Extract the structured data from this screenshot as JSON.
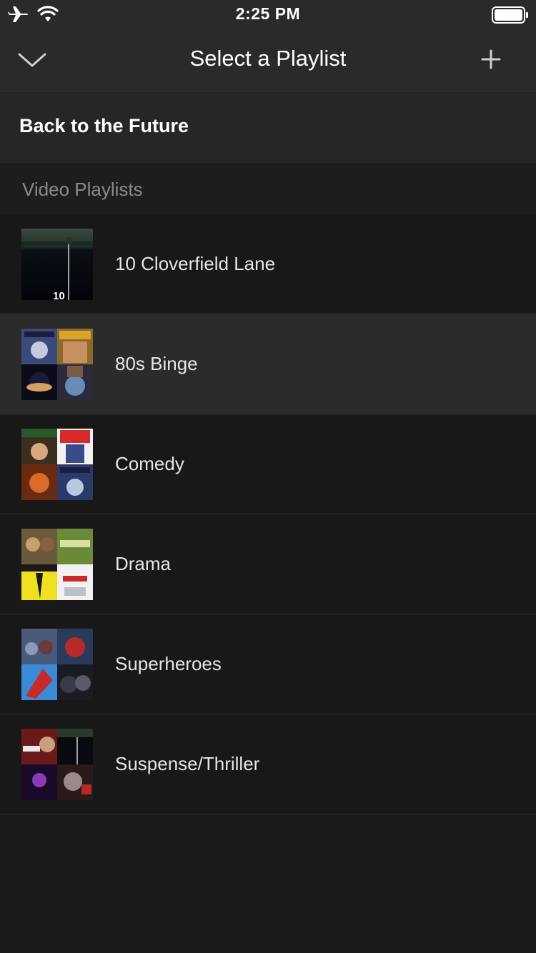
{
  "status_bar": {
    "time": "2:25 PM",
    "icons": [
      "airplane-icon",
      "wifi-icon",
      "battery-icon"
    ]
  },
  "nav": {
    "title": "Select a Playlist",
    "back_icon": "chevron-down-icon",
    "add_icon": "plus-icon"
  },
  "now_playing": {
    "label": "Back to the Future"
  },
  "section": {
    "label": "Video Playlists"
  },
  "playlists": [
    {
      "label": "10 Cloverfield Lane",
      "selected": false,
      "thumb_text": "10"
    },
    {
      "label": "80s Binge",
      "selected": true
    },
    {
      "label": "Comedy",
      "selected": false
    },
    {
      "label": "Drama",
      "selected": false
    },
    {
      "label": "Superheroes",
      "selected": false
    },
    {
      "label": "Suspense/Thriller",
      "selected": false
    }
  ],
  "colors": {
    "background": "#1a1a1a",
    "nav_background": "#2a2a2a",
    "selected_row": "#2b2b2b",
    "section_text": "#8a8a8a",
    "text": "#ffffff"
  }
}
